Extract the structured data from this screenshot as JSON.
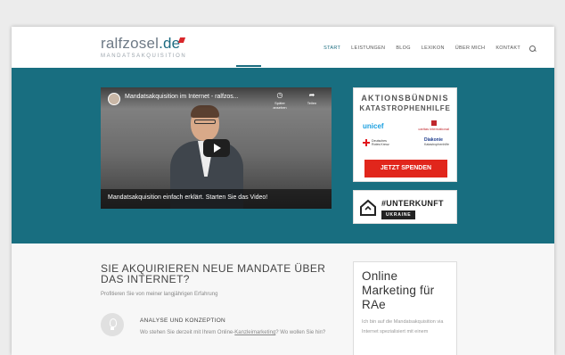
{
  "header": {
    "logo_main": "ralfzosel",
    "logo_tld": ".de",
    "logo_sub": "MANDATSAKQUISITION",
    "nav": [
      "START",
      "LEISTUNGEN",
      "BLOG",
      "LEXIKON",
      "ÜBER MICH",
      "KONTAKT"
    ],
    "active_nav": "START",
    "search_icon": "search-icon"
  },
  "video": {
    "title": "Mandatsakquisition im Internet - ralfzos...",
    "watch_later": "Später ansehen",
    "share": "Teilen",
    "caption": "Mandatsakquisition einfach erklärt. Starten Sie das Video!"
  },
  "donation": {
    "title_line1": "AKTIONSBÜNDNIS",
    "title_line2": "KATASTROPHENHILFE",
    "unicef": "unicef",
    "caritas": "caritas international",
    "drk": "Deutsches Rotes Kreuz",
    "diakonie": "Diakonie",
    "diakonie_sub": "Katastrophenhilfe",
    "button": "JETZT SPENDEN"
  },
  "ukraine": {
    "title": "#UNTERKUNFT",
    "badge": "UKRAINE"
  },
  "main": {
    "headline": "SIE AKQUIRIEREN NEUE MANDATE ÜBER DAS INTERNET?",
    "subline": "Profitieren Sie von meiner langjährigen Erfahrung",
    "feature_title": "ANALYSE UND KONZEPTION",
    "feature_text_1": "Wo stehen Sie derzeit mit Ihrem Online-",
    "feature_link": "Kanzleimarketing",
    "feature_text_2": "? Wo wollen Sie hin?"
  },
  "sidebox": {
    "title": "Online Marketing für RAe",
    "text": "Ich bin auf die Mandatsakquisition via Internet spezialisiert mit einem"
  },
  "colors": {
    "accent": "#186e80",
    "donate": "#e1261c"
  }
}
